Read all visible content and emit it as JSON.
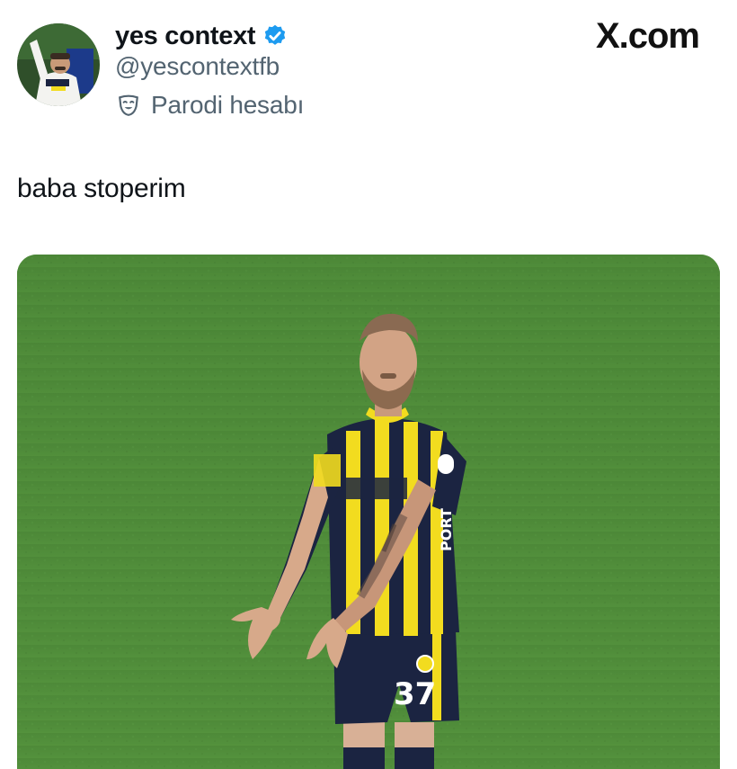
{
  "tweet": {
    "display_name": "yes context",
    "handle": "@yescontextfb",
    "account_label": "Parodi hesabı",
    "text": "baba stoperim",
    "verified": true
  },
  "brand": {
    "label": "X.com"
  },
  "media": {
    "jersey_number": "37",
    "sleeve_text": "PORT"
  },
  "icons": {
    "verified": "verified-badge-icon",
    "parody": "parody-mask-icon"
  },
  "colors": {
    "verified_blue": "#1d9bf0",
    "secondary_text": "#536471",
    "pitch_green": "#4d8a3a",
    "kit_navy": "#1b2441",
    "kit_yellow": "#f2dc1f"
  }
}
